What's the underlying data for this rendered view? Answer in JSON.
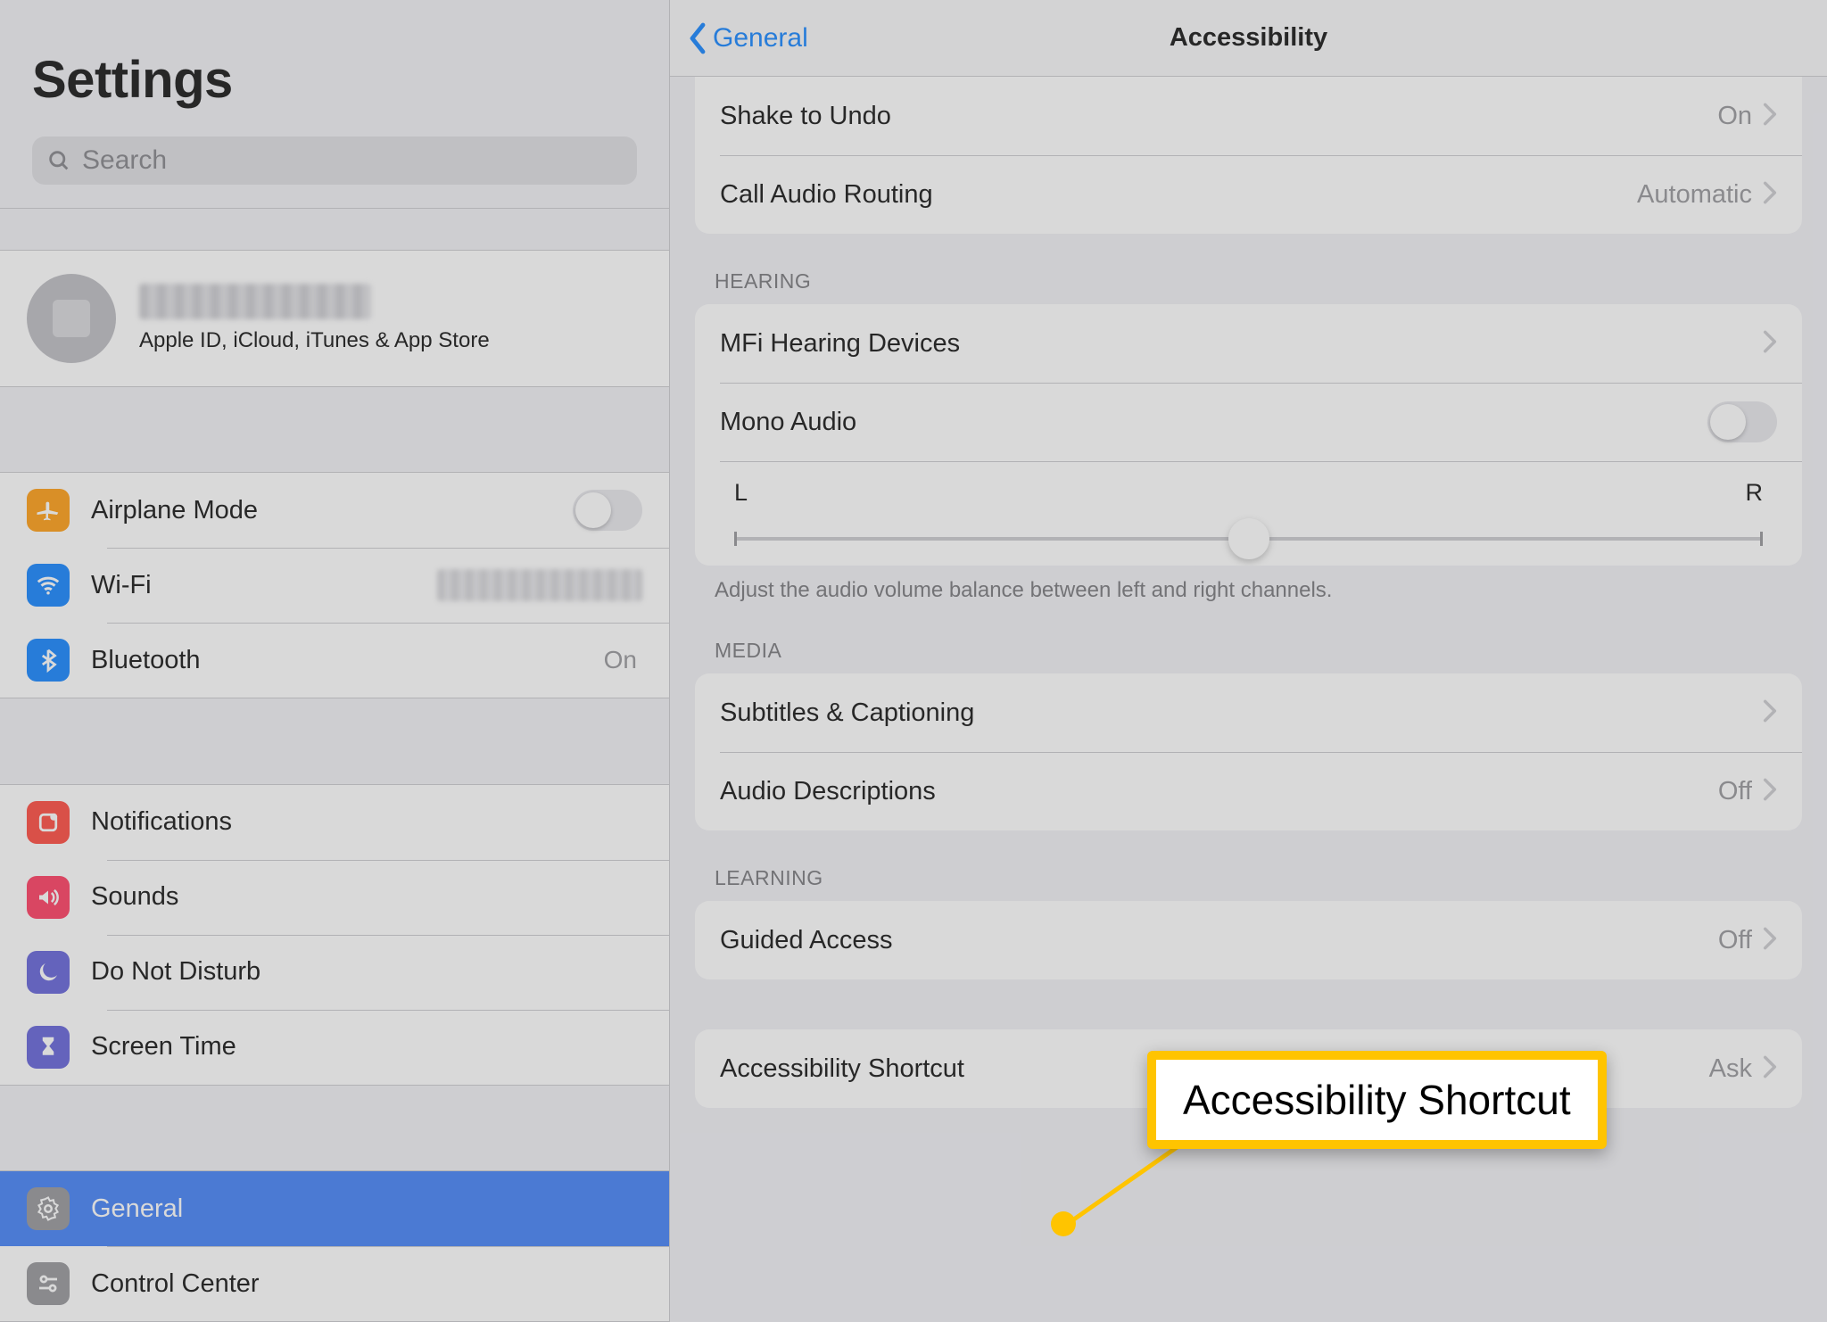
{
  "sidebar": {
    "title": "Settings",
    "search_placeholder": "Search",
    "account_subtitle": "Apple ID, iCloud, iTunes & App Store",
    "items_g1": {
      "airplane": "Airplane Mode",
      "wifi": "Wi-Fi",
      "bluetooth": "Bluetooth",
      "bluetooth_value": "On"
    },
    "items_g2": {
      "notifications": "Notifications",
      "sounds": "Sounds",
      "dnd": "Do Not Disturb",
      "screentime": "Screen Time"
    },
    "items_g3": {
      "general": "General",
      "controlcenter": "Control Center"
    }
  },
  "detail": {
    "back_label": "General",
    "nav_title": "Accessibility",
    "rows_top": {
      "shake": "Shake to Undo",
      "shake_value": "On",
      "call_routing": "Call Audio Routing",
      "call_routing_value": "Automatic"
    },
    "hearing_header": "HEARING",
    "hearing": {
      "mfi": "MFi Hearing Devices",
      "mono": "Mono Audio",
      "balance_left": "L",
      "balance_right": "R"
    },
    "hearing_footer": "Adjust the audio volume balance between left and right channels.",
    "media_header": "MEDIA",
    "media": {
      "subtitles": "Subtitles & Captioning",
      "audiodesc": "Audio Descriptions",
      "audiodesc_value": "Off"
    },
    "learning_header": "LEARNING",
    "learning": {
      "guided": "Guided Access",
      "guided_value": "Off"
    },
    "shortcut": {
      "label": "Accessibility Shortcut",
      "value": "Ask"
    }
  },
  "callout": {
    "text": "Accessibility Shortcut"
  }
}
